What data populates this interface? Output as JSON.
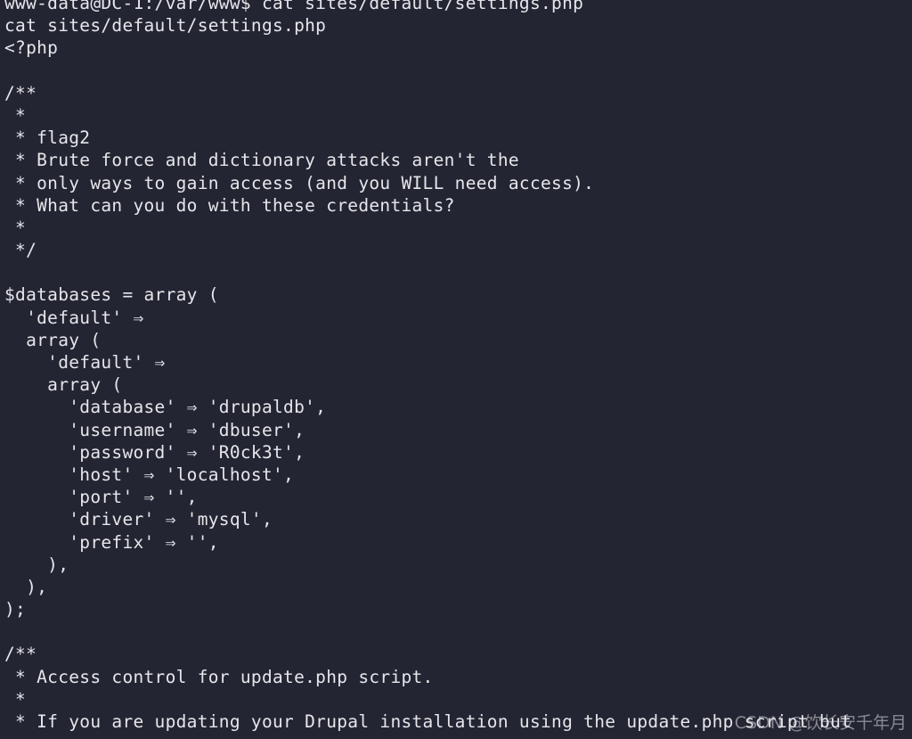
{
  "terminal": {
    "lines": [
      "www-data@DC-1:/var/www$ cat sites/default/settings.php",
      "cat sites/default/settings.php",
      "<?php",
      "",
      "/**",
      " *",
      " * flag2",
      " * Brute force and dictionary attacks aren't the",
      " * only ways to gain access (and you WILL need access).",
      " * What can you do with these credentials?",
      " *",
      " */",
      "",
      "$databases = array (",
      "  'default' ⇒",
      "  array (",
      "    'default' ⇒",
      "    array (",
      "      'database' ⇒ 'drupaldb',",
      "      'username' ⇒ 'dbuser',",
      "      'password' ⇒ 'R0ck3t',",
      "      'host' ⇒ 'localhost',",
      "      'port' ⇒ '',",
      "      'driver' ⇒ 'mysql',",
      "      'prefix' ⇒ '',",
      "    ),",
      "  ),",
      ");",
      "",
      "/**",
      " * Access control for update.php script.",
      " *",
      " * If you are updating your Drupal installation using the update.php script but"
    ],
    "colors": {
      "background": "#232533",
      "foreground": "#e6e6ea"
    }
  },
  "watermark": "CSDN @饮长安千年月"
}
